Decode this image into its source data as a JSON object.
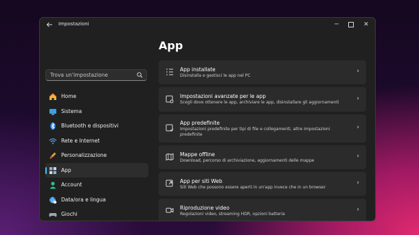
{
  "window": {
    "title": "Impostazioni",
    "back_icon": "arrow-left-icon",
    "controls": {
      "minimize": "─",
      "close": "✕"
    }
  },
  "search": {
    "placeholder": "Trova un'impostazione",
    "icon": "search-icon"
  },
  "sidebar": {
    "items": [
      {
        "label": "Home",
        "icon": "home-icon",
        "active": false
      },
      {
        "label": "Sistema",
        "icon": "monitor-icon",
        "active": false
      },
      {
        "label": "Bluetooth e dispositivi",
        "icon": "bluetooth-icon",
        "active": false
      },
      {
        "label": "Rete e Internet",
        "icon": "wifi-icon",
        "active": false
      },
      {
        "label": "Personalizzazione",
        "icon": "brush-icon",
        "active": false
      },
      {
        "label": "App",
        "icon": "apps-icon",
        "active": true
      },
      {
        "label": "Account",
        "icon": "account-icon",
        "active": false
      },
      {
        "label": "Data/ora e lingua",
        "icon": "globe-clock-icon",
        "active": false
      },
      {
        "label": "Giochi",
        "icon": "gamepad-icon",
        "active": false
      }
    ]
  },
  "main": {
    "title": "App",
    "cards": [
      {
        "title": "App installate",
        "desc": "Disinstalla e gestisci le app nel PC",
        "icon": "list-icon"
      },
      {
        "title": "Impostazioni avanzate per le app",
        "desc": "Scegli dove ottenere le app, archiviare le app, disinstallare gli aggiornamenti",
        "icon": "app-settings-icon"
      },
      {
        "title": "App predefinite",
        "desc": "Impostazioni predefinite per tipi di file e collegamenti, altre impostazioni predefinite",
        "icon": "default-apps-icon"
      },
      {
        "title": "Mappe offline",
        "desc": "Download, percorso di archiviazione, aggiornamenti delle mappe",
        "icon": "map-icon"
      },
      {
        "title": "App per siti Web",
        "desc": "Siti Web che possono essere aperti in un'app invece che in un browser",
        "icon": "web-app-icon"
      },
      {
        "title": "Riproduzione video",
        "desc": "Regolazioni video, streaming HDR, opzioni batteria",
        "icon": "video-icon"
      }
    ],
    "chevron": "›"
  },
  "colors": {
    "accent": "#4cc2ff",
    "window_bg": "#202020",
    "card_bg": "#2b2b2b"
  }
}
